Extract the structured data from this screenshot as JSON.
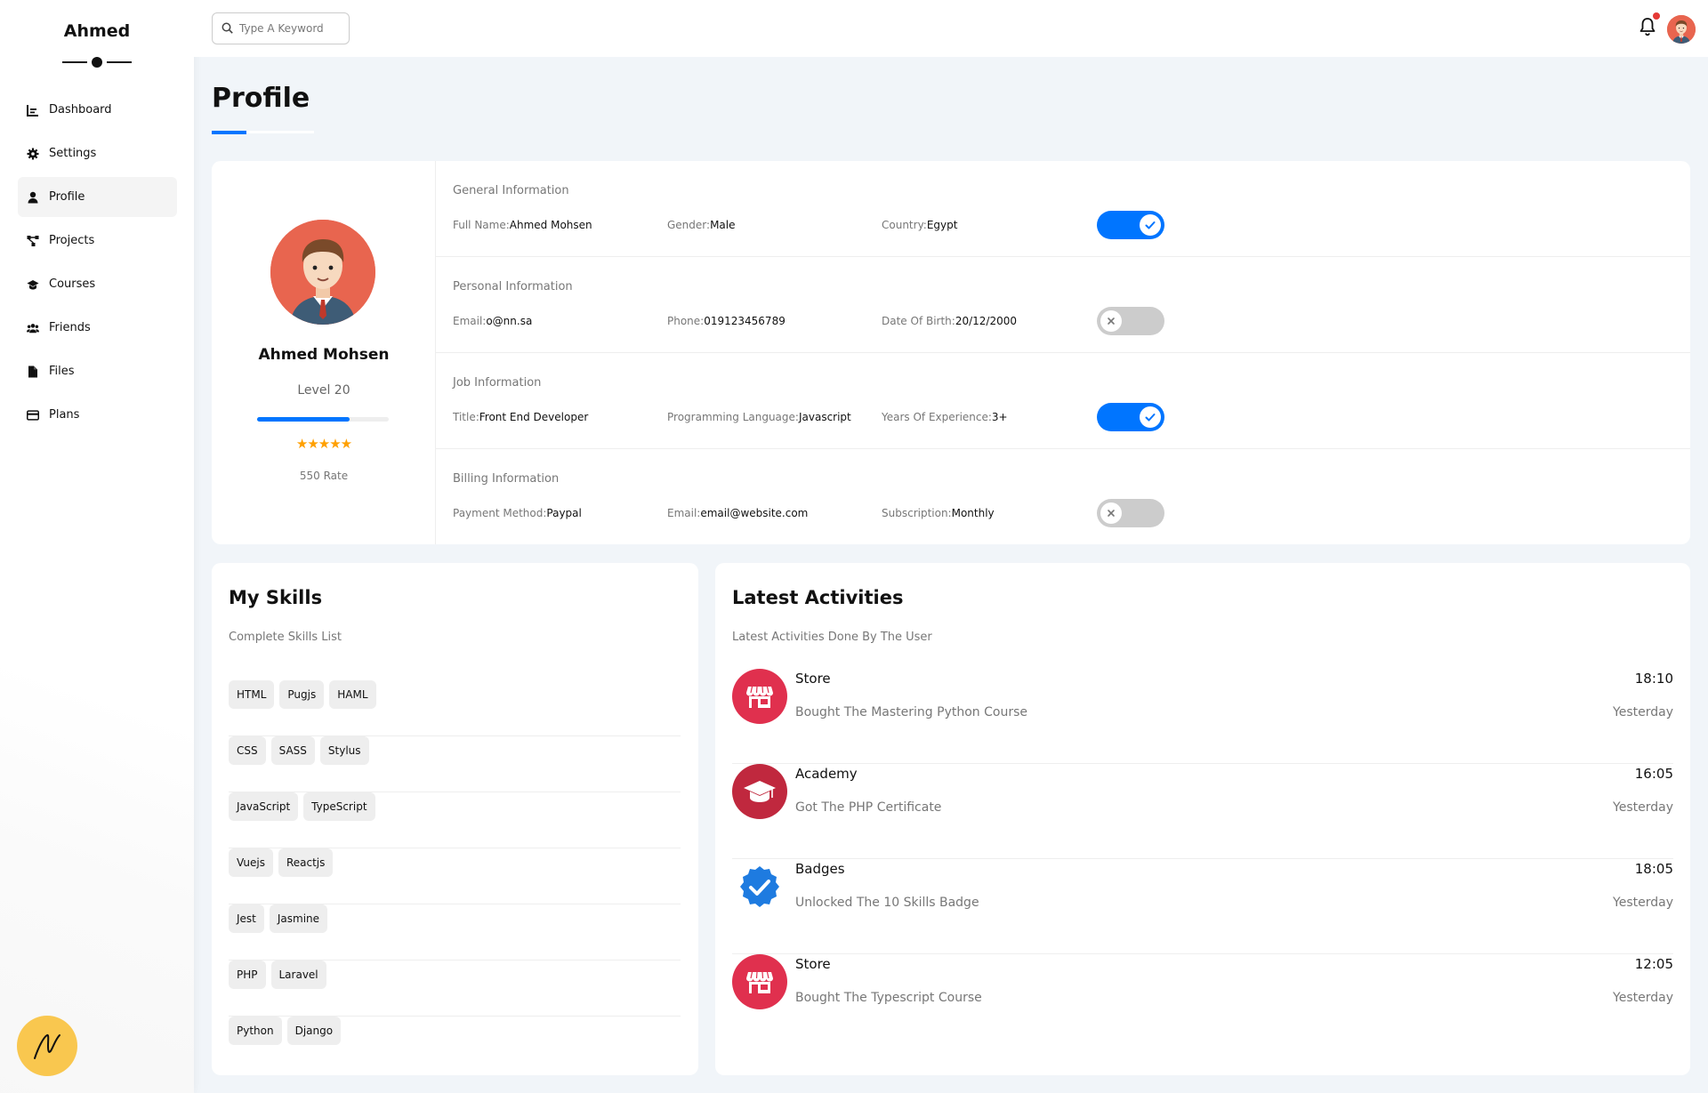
{
  "sidebar": {
    "brand": "Ahmed",
    "items": [
      {
        "label": "Dashboard",
        "icon": "chart-icon"
      },
      {
        "label": "Settings",
        "icon": "gear-icon"
      },
      {
        "label": "Profile",
        "icon": "user-icon",
        "active": true
      },
      {
        "label": "Projects",
        "icon": "diagram-icon"
      },
      {
        "label": "Courses",
        "icon": "graduation-cap-icon"
      },
      {
        "label": "Friends",
        "icon": "users-icon"
      },
      {
        "label": "Files",
        "icon": "file-icon"
      },
      {
        "label": "Plans",
        "icon": "credit-card-icon"
      }
    ]
  },
  "topbar": {
    "search_placeholder": "Type A Keyword",
    "has_notification": true
  },
  "page": {
    "title": "Profile"
  },
  "profile": {
    "name": "Ahmed Mohsen",
    "level": "Level 20",
    "level_progress": 0.7,
    "stars": 5,
    "rate": "550 Rate"
  },
  "info_sections": [
    {
      "title": "General Information",
      "fields": [
        {
          "label": "Full Name:",
          "value": "Ahmed Mohsen"
        },
        {
          "label": "Gender:",
          "value": "Male"
        },
        {
          "label": "Country:",
          "value": "Egypt"
        }
      ],
      "toggle_on": true
    },
    {
      "title": "Personal Information",
      "fields": [
        {
          "label": "Email:",
          "value": "o@nn.sa"
        },
        {
          "label": "Phone:",
          "value": "019123456789"
        },
        {
          "label": "Date Of Birth:",
          "value": "20/12/2000"
        }
      ],
      "toggle_on": false
    },
    {
      "title": "Job Information",
      "fields": [
        {
          "label": "Title:",
          "value": "Front End Developer"
        },
        {
          "label": "Programming Language:",
          "value": "Javascript"
        },
        {
          "label": "Years Of Experience:",
          "value": "3+"
        }
      ],
      "toggle_on": true
    },
    {
      "title": "Billing Information",
      "fields": [
        {
          "label": "Payment Method:",
          "value": "Paypal"
        },
        {
          "label": "Email:",
          "value": "email@website.com"
        },
        {
          "label": "Subscription:",
          "value": "Monthly"
        }
      ],
      "toggle_on": false
    }
  ],
  "skills": {
    "title": "My Skills",
    "subtitle": "Complete Skills List",
    "rows": [
      [
        "HTML",
        "Pugjs",
        "HAML"
      ],
      [
        "CSS",
        "SASS",
        "Stylus"
      ],
      [
        "JavaScript",
        "TypeScript"
      ],
      [
        "Vuejs",
        "Reactjs"
      ],
      [
        "Jest",
        "Jasmine"
      ],
      [
        "PHP",
        "Laravel"
      ],
      [
        "Python",
        "Django"
      ]
    ]
  },
  "activities": {
    "title": "Latest Activities",
    "subtitle": "Latest Activities Done By The User",
    "items": [
      {
        "name": "Store",
        "desc": "Bought The Mastering Python Course",
        "time": "18:10",
        "day": "Yesterday",
        "icon": "store-icon",
        "color": "#e0304e"
      },
      {
        "name": "Academy",
        "desc": "Got The PHP Certificate",
        "time": "16:05",
        "day": "Yesterday",
        "icon": "graduation-cap-icon",
        "color": "#c0283e"
      },
      {
        "name": "Badges",
        "desc": "Unlocked The 10 Skills Badge",
        "time": "18:05",
        "day": "Yesterday",
        "icon": "badge-check-icon",
        "color": "#1e7be0"
      },
      {
        "name": "Store",
        "desc": "Bought The Typescript Course",
        "time": "12:05",
        "day": "Yesterday",
        "icon": "store-icon",
        "color": "#e0304e"
      }
    ]
  },
  "colors": {
    "accent": "#0075ff",
    "background": "#f1f5f9",
    "star": "#ffa000",
    "fab": "#f9c74f"
  }
}
